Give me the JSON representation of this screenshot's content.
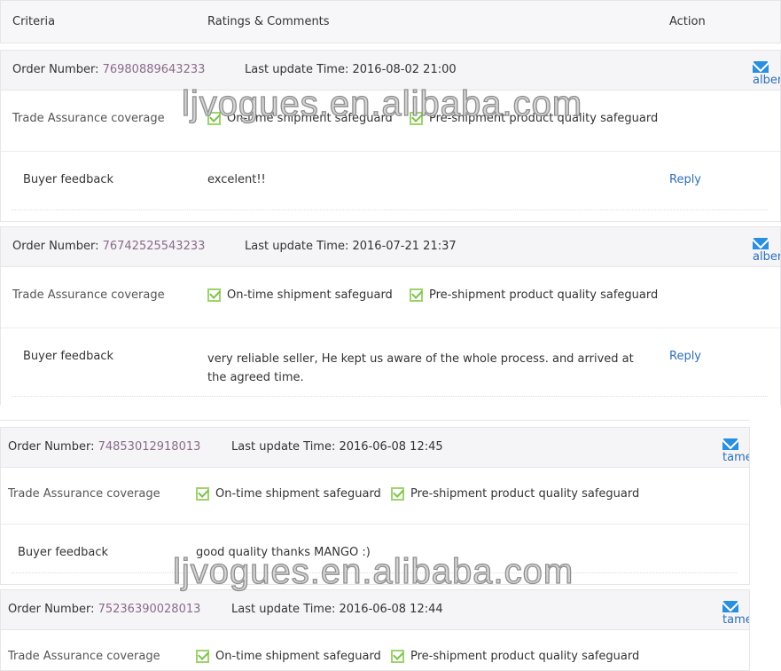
{
  "header": {
    "criteria": "Criteria",
    "ratings": "Ratings & Comments",
    "action": "Action"
  },
  "labels": {
    "order_number": "Order Number:",
    "last_update": "Last update Time:",
    "trade": "Trade Assurance coverage",
    "ontime": "On-time shipment safeguard",
    "preship": "Pre-shipment product quality safeguard",
    "buyer": "Buyer feedback",
    "reply": "Reply"
  },
  "orders": [
    {
      "number": "76980889643233",
      "time": "2016-08-02 21:00",
      "user": "alberto",
      "feedback": "excelent!!"
    },
    {
      "number": "76742525543233",
      "time": "2016-07-21 21:37",
      "user": "alberto",
      "feedback": "very reliable seller, He kept us aware of the whole process. and arrived at the agreed time."
    },
    {
      "number": "74853012918013",
      "time": "2016-06-08 12:45",
      "user": "tamer",
      "feedback": "good quality thanks MANGO :)"
    },
    {
      "number": "75236390028013",
      "time": "2016-06-08 12:44",
      "user": "tamer"
    }
  ],
  "watermark": "ljvogues.en.alibaba.com"
}
